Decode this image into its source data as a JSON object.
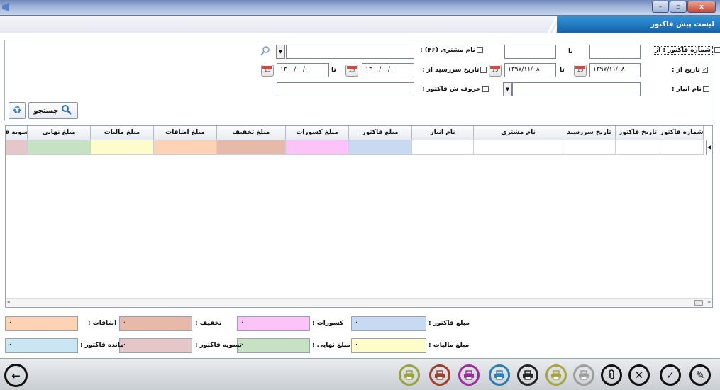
{
  "window": {
    "min": "–",
    "max": "▫",
    "close": "x"
  },
  "header": {
    "title": "لیست پیش فاکتور"
  },
  "filters": {
    "invoice_no": {
      "label": "شماره فاکتور : از",
      "from": "",
      "to_label": "تا",
      "to": ""
    },
    "customer": {
      "label": "نام مشتری (۴۶) :",
      "value": ""
    },
    "date": {
      "label": "تاریخ از :",
      "checked": "✓",
      "from": "۱۳۹۷/۱۱/۰۸",
      "to_label": "تا",
      "to": "۱۳۹۷/۱۱/۰۸"
    },
    "due_date": {
      "label": "تاریخ سررسید از :",
      "from": "۱۳۰۰/۰۰/۰۰",
      "to_label": "تا",
      "to": "۱۳۰۰/۰۰/۰۰"
    },
    "warehouse": {
      "label": "نام انبار :",
      "value": ""
    },
    "letters": {
      "label": "حروف ش فاکتور :",
      "value": ""
    },
    "search_label": "جستجو",
    "calendar_text": "15"
  },
  "grid": {
    "columns": [
      {
        "label": "تسویه ف",
        "color": "#e6c7c7"
      },
      {
        "label": "مبلغ نهایی",
        "color": "#c6e2c3"
      },
      {
        "label": "مبلغ مالیات",
        "color": "#fdfdc9"
      },
      {
        "label": "مبلغ اضافات",
        "color": "#fdd3b3"
      },
      {
        "label": "مبلغ تخفیف",
        "color": "#e6b9a8"
      },
      {
        "label": "مبلغ کسورات",
        "color": "#fbc3f7"
      },
      {
        "label": "مبلغ فاکتور",
        "color": "#c7daf2"
      },
      {
        "label": "نام انبار",
        "color": "#ffffff"
      },
      {
        "label": "نام مشتری",
        "color": "#ffffff"
      },
      {
        "label": "تاریخ سررسید",
        "color": "#ffffff"
      },
      {
        "label": "تاریخ فاکتور",
        "color": "#ffffff"
      },
      {
        "label": "شماره فاکتور",
        "color": "#ffffff"
      }
    ],
    "row_indicator": "◀"
  },
  "summary": {
    "invoice_amount": {
      "label": "مبلغ فاکتور :",
      "value": "۰",
      "color": "#c7daf2"
    },
    "deductions": {
      "label": "کسورات :",
      "value": "۰",
      "color": "#fbc3f7"
    },
    "discount": {
      "label": "تخفیف :",
      "value": "۰",
      "color": "#e6b9a8"
    },
    "additions": {
      "label": "اضافات :",
      "value": "۰",
      "color": "#fdd3b3"
    },
    "tax": {
      "label": "مبلغ مالیات :",
      "value": "۰",
      "color": "#fdfdc9"
    },
    "final": {
      "label": "مبلغ نهایی :",
      "value": "۰",
      "color": "#c6e2c3"
    },
    "settlement": {
      "label": "تسویه فاکتور :",
      "value": "۰",
      "color": "#e6c7c7"
    },
    "remaining": {
      "label": "مانده فاکتور :",
      "value": "۰",
      "color": "#c9e6f2"
    }
  },
  "toolbar": {
    "back": "←",
    "print_colors": [
      "#9aa33a",
      "#a0402a",
      "#9b2d9b",
      "#2d7fb0",
      "#222222",
      "#a7a63c",
      "#9e9e9e"
    ],
    "attach": "⏚",
    "delete": "✕",
    "confirm": "✓",
    "edit": "✎"
  }
}
